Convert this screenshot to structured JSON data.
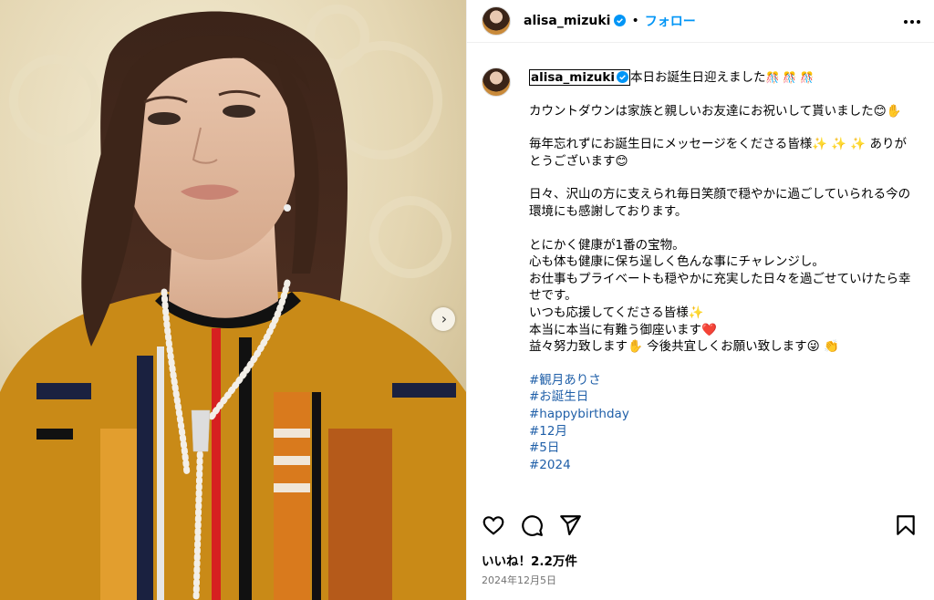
{
  "header": {
    "username": "alisa_mizuki",
    "separator": "•",
    "follow_label": "フォロー"
  },
  "caption": {
    "username": "alisa_mizuki",
    "first_line": "本日お誕生日迎えました",
    "first_line_emoji": "🎊 🎊 🎊",
    "paragraphs": [
      [
        "カウントダウンは家族と親しいお友達にお祝いして貰いました😊✋"
      ],
      [
        "毎年忘れずにお誕生日にメッセージをくださる皆様✨ ✨ ✨ ありがとうございます😊"
      ],
      [
        "日々、沢山の方に支えられ毎日笑顔で穏やかに過ごしていられる今の環境にも感謝しております。"
      ],
      [
        "とにかく健康が1番の宝物。",
        "心も体も健康に保ち逞しく色んな事にチャレンジし。",
        "お仕事もプライベートも穏やかに充実した日々を過ごせていけたら幸せです。",
        "いつも応援してくださる皆様✨",
        "本当に本当に有難う御座います❤️",
        "益々努力致します✋ 今後共宜しくお願い致します😜 👏"
      ]
    ],
    "hashtags": [
      "#観月ありさ",
      "#お誕生日",
      "#happybirthday",
      "#12月",
      "#5日",
      "#2024"
    ]
  },
  "actions": {
    "like": "heart-icon",
    "comment": "comment-icon",
    "share": "share-icon",
    "save": "bookmark-icon"
  },
  "likes_text": "いいね！2.2万件",
  "date_text": "2024年12月5日",
  "colors": {
    "link": "#0095f6",
    "hashtag": "#1f5fa8",
    "date": "#737373"
  }
}
